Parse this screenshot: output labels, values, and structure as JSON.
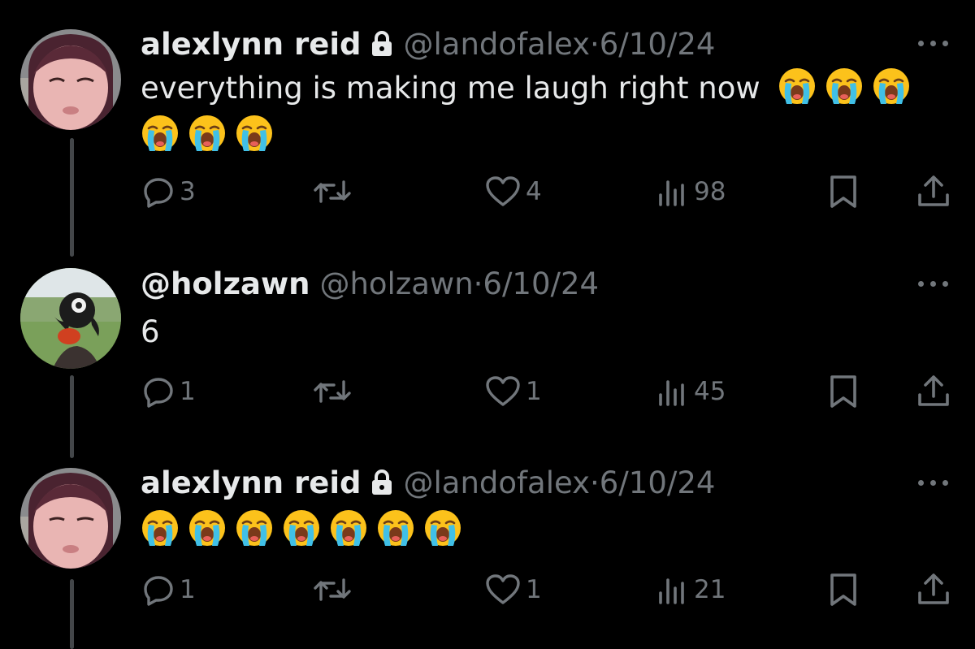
{
  "colors": {
    "background": "#000000",
    "primary_text": "#e7e9ea",
    "secondary_text": "#71767b",
    "thread_line": "#434649",
    "emoji_face": "#fcc21b",
    "emoji_tears": "#40c0e7"
  },
  "tweets": [
    {
      "display_name": "alexlynn reid",
      "protected": true,
      "handle": "@landofalex",
      "separator": "·",
      "date": "6/10/24",
      "text": "everything is making me laugh right now",
      "emoji": [
        "loudly-crying-face",
        "loudly-crying-face",
        "loudly-crying-face",
        "loudly-crying-face",
        "loudly-crying-face",
        "loudly-crying-face"
      ],
      "replies": "3",
      "reposts": "",
      "likes": "4",
      "views": "98"
    },
    {
      "display_name": "@holzawn",
      "protected": false,
      "handle": "@holzawn",
      "separator": "·",
      "date": "6/10/24",
      "text": "6",
      "emoji": [],
      "replies": "1",
      "reposts": "",
      "likes": "1",
      "views": "45"
    },
    {
      "display_name": "alexlynn reid",
      "protected": true,
      "handle": "@landofalex",
      "separator": "·",
      "date": "6/10/24",
      "text": "",
      "emoji": [
        "loudly-crying-face",
        "loudly-crying-face",
        "loudly-crying-face",
        "loudly-crying-face",
        "loudly-crying-face",
        "loudly-crying-face",
        "loudly-crying-face"
      ],
      "replies": "1",
      "reposts": "",
      "likes": "1",
      "views": "21"
    }
  ],
  "icons": {
    "reply": "speech-bubble-icon",
    "repost": "repost-arrows-icon",
    "like": "heart-icon",
    "views": "bar-chart-icon",
    "bookmark": "bookmark-icon",
    "share": "share-upload-icon",
    "more": "three-dots-icon",
    "lock": "lock-icon"
  }
}
